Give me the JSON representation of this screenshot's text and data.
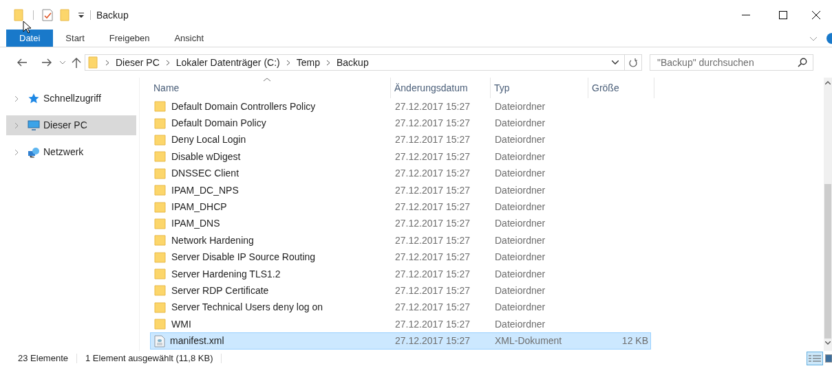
{
  "window": {
    "title": "Backup"
  },
  "ribbon_tabs": [
    {
      "label": "Datei",
      "selected": true
    },
    {
      "label": "Start",
      "selected": false
    },
    {
      "label": "Freigeben",
      "selected": false
    },
    {
      "label": "Ansicht",
      "selected": false
    }
  ],
  "address_bar": {
    "crumbs": [
      "Dieser PC",
      "Lokaler Datenträger (C:)",
      "Temp",
      "Backup"
    ]
  },
  "search": {
    "placeholder": "\"Backup\" durchsuchen"
  },
  "sidebar": {
    "items": [
      {
        "label": "Schnellzugriff",
        "kind": "star",
        "selected": false
      },
      {
        "label": "Dieser PC",
        "kind": "pc",
        "selected": true
      },
      {
        "label": "Netzwerk",
        "kind": "network",
        "selected": false
      }
    ]
  },
  "table": {
    "columns": [
      "Name",
      "Änderungsdatum",
      "Typ",
      "Größe"
    ],
    "rows": [
      {
        "name": "Default Domain Controllers Policy",
        "date": "27.12.2017 15:27",
        "type": "Dateiordner",
        "kind": "folder",
        "selected": false
      },
      {
        "name": "Default Domain Policy",
        "date": "27.12.2017 15:27",
        "type": "Dateiordner",
        "kind": "folder",
        "selected": false
      },
      {
        "name": "Deny Local Login",
        "date": "27.12.2017 15:27",
        "type": "Dateiordner",
        "kind": "folder",
        "selected": false
      },
      {
        "name": "Disable wDigest",
        "date": "27.12.2017 15:27",
        "type": "Dateiordner",
        "kind": "folder",
        "selected": false
      },
      {
        "name": "DNSSEC Client",
        "date": "27.12.2017 15:27",
        "type": "Dateiordner",
        "kind": "folder",
        "selected": false
      },
      {
        "name": "IPAM_DC_NPS",
        "date": "27.12.2017 15:27",
        "type": "Dateiordner",
        "kind": "folder",
        "selected": false
      },
      {
        "name": "IPAM_DHCP",
        "date": "27.12.2017 15:27",
        "type": "Dateiordner",
        "kind": "folder",
        "selected": false
      },
      {
        "name": "IPAM_DNS",
        "date": "27.12.2017 15:27",
        "type": "Dateiordner",
        "kind": "folder",
        "selected": false
      },
      {
        "name": "Network Hardening",
        "date": "27.12.2017 15:27",
        "type": "Dateiordner",
        "kind": "folder",
        "selected": false
      },
      {
        "name": "Server Disable IP Source Routing",
        "date": "27.12.2017 15:27",
        "type": "Dateiordner",
        "kind": "folder",
        "selected": false
      },
      {
        "name": "Server Hardening TLS1.2",
        "date": "27.12.2017 15:27",
        "type": "Dateiordner",
        "kind": "folder",
        "selected": false
      },
      {
        "name": "Server RDP Certificate",
        "date": "27.12.2017 15:27",
        "type": "Dateiordner",
        "kind": "folder",
        "selected": false
      },
      {
        "name": "Server Technical Users deny log on",
        "date": "27.12.2017 15:27",
        "type": "Dateiordner",
        "kind": "folder",
        "selected": false
      },
      {
        "name": "WMI",
        "date": "27.12.2017 15:27",
        "type": "Dateiordner",
        "kind": "folder",
        "selected": false
      },
      {
        "name": "manifest.xml",
        "date": "27.12.2017 15:27",
        "type": "XML-Dokument",
        "size": "12 KB",
        "kind": "file",
        "selected": true
      }
    ]
  },
  "status_bar": {
    "count": "23 Elemente",
    "selection": "1 Element ausgewählt (11,8 KB)"
  }
}
